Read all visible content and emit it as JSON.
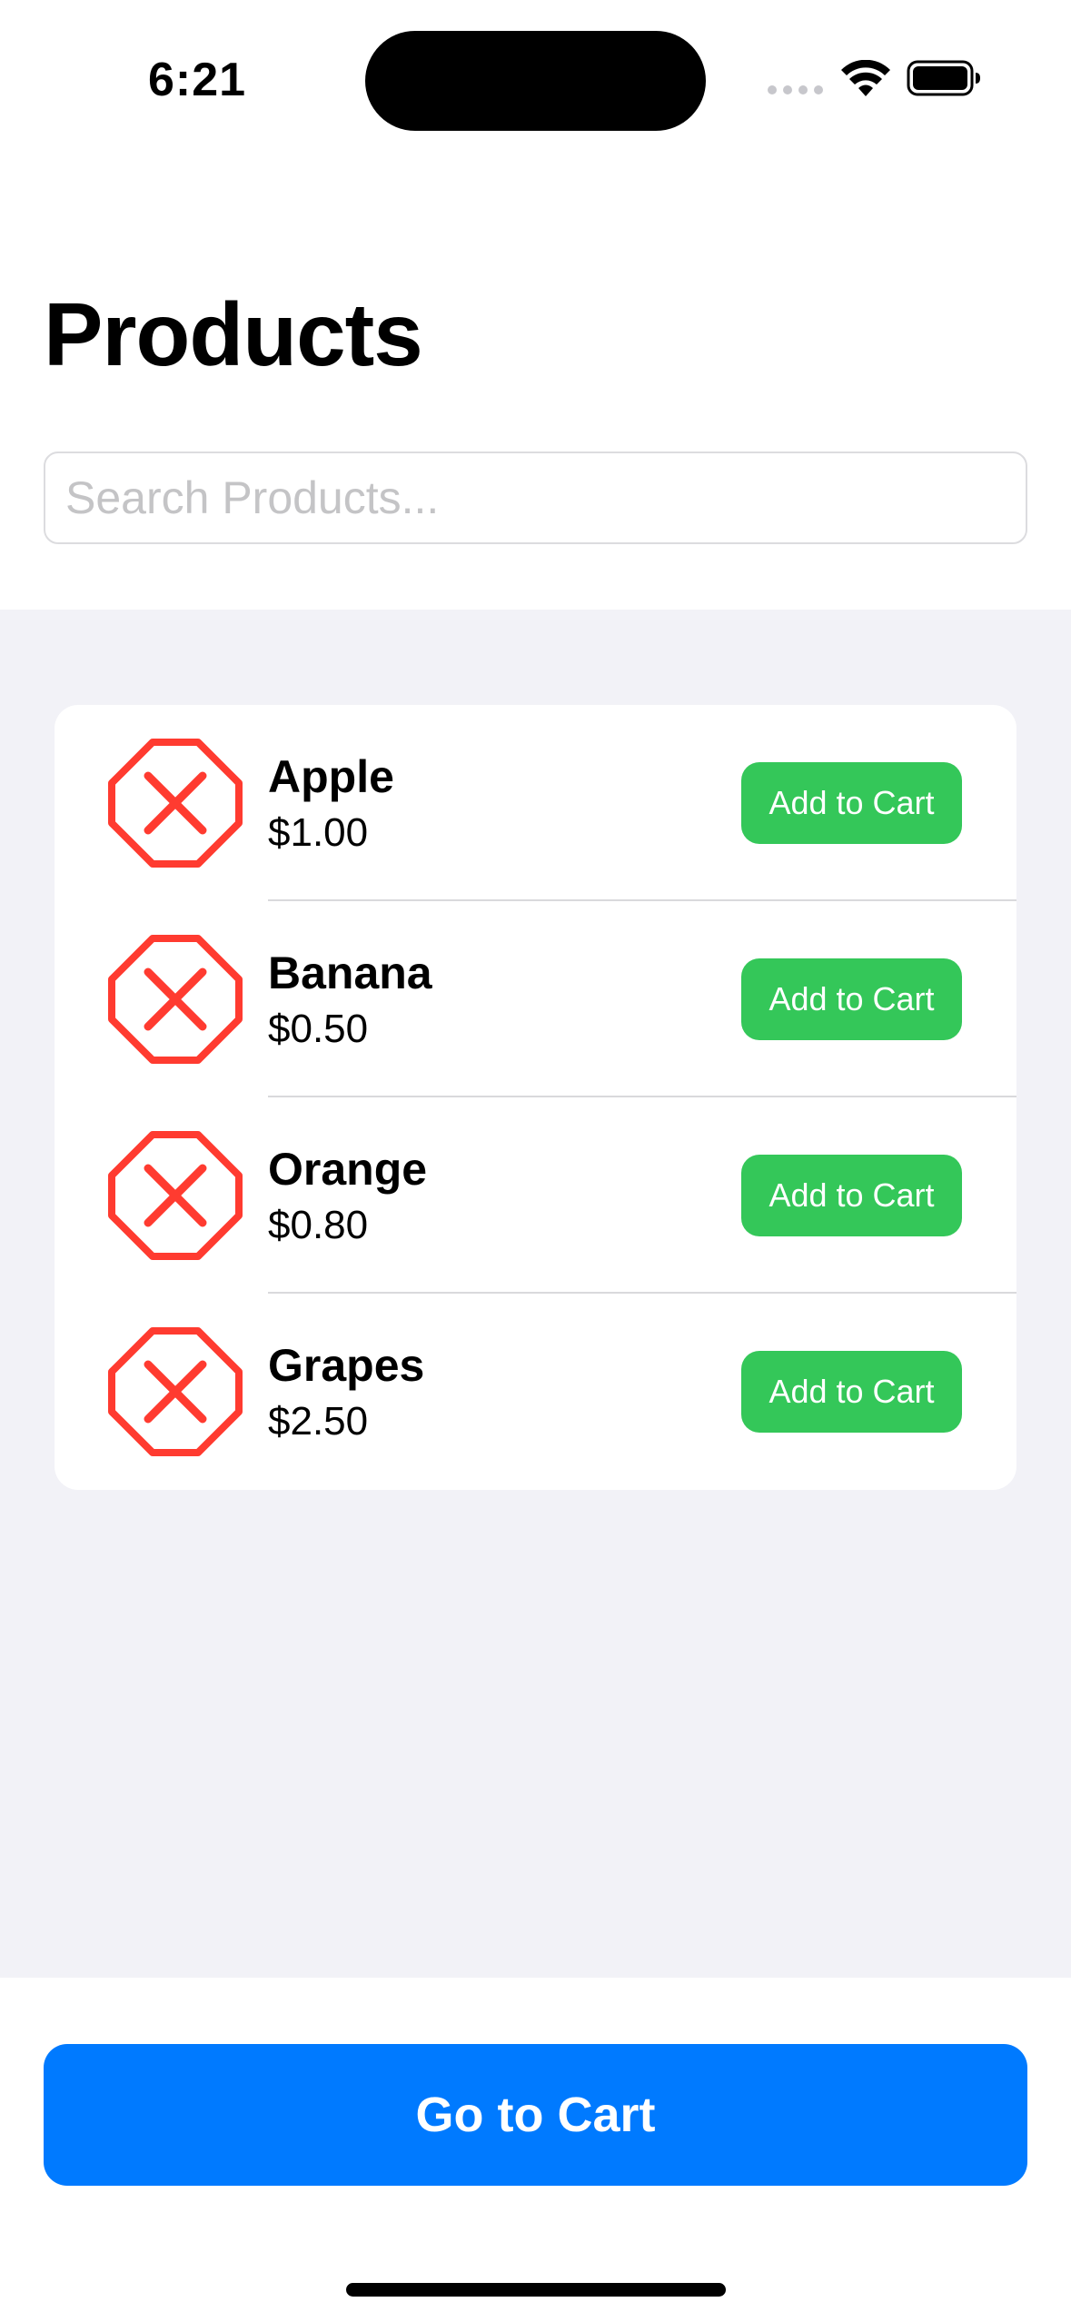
{
  "status_bar": {
    "time": "6:21",
    "icons": [
      "cellular-dots-icon",
      "wifi-icon",
      "battery-icon"
    ]
  },
  "header": {
    "title": "Products",
    "search_placeholder": "Search Products..."
  },
  "products": [
    {
      "name": "Apple",
      "price": "$1.00",
      "button_label": "Add to Cart",
      "icon": "xmark-octagon-icon"
    },
    {
      "name": "Banana",
      "price": "$0.50",
      "button_label": "Add to Cart",
      "icon": "xmark-octagon-icon"
    },
    {
      "name": "Orange",
      "price": "$0.80",
      "button_label": "Add to Cart",
      "icon": "xmark-octagon-icon"
    },
    {
      "name": "Grapes",
      "price": "$2.50",
      "button_label": "Add to Cart",
      "icon": "xmark-octagon-icon"
    }
  ],
  "footer": {
    "cart_button_label": "Go to Cart"
  },
  "colors": {
    "accent_blue": "#007aff",
    "add_green": "#34c759",
    "icon_red": "#ff3b30",
    "list_background": "#f2f2f7"
  }
}
